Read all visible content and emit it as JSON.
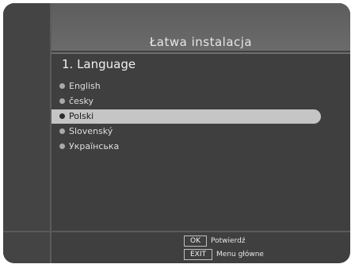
{
  "screen": {
    "title": "Łatwa instalacja",
    "section_title": "1. Language"
  },
  "languages": [
    {
      "label": "English",
      "selected": false
    },
    {
      "label": "česky",
      "selected": false
    },
    {
      "label": "Polski",
      "selected": true
    },
    {
      "label": "Slovenský",
      "selected": false
    },
    {
      "label": "Українська",
      "selected": false
    }
  ],
  "footer": {
    "ok_key": "OK",
    "ok_label": "Potwierdź",
    "exit_key": "EXIT",
    "exit_label": "Menu główne"
  },
  "colors": {
    "background": "#3f3f3f",
    "highlight": "#c5c5c5",
    "text": "#dedede"
  }
}
